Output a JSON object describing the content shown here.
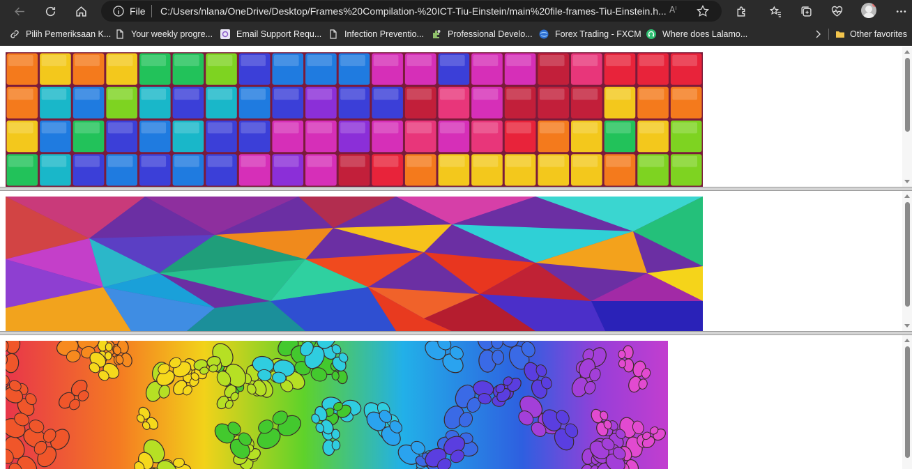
{
  "address_bar": {
    "scheme_label": "File",
    "url": "C:/Users/nlana/OneDrive/Desktop/Frames%20Compilation-%20ICT-Tiu-Einstein/main%20file-frames-Tiu-Einstein.h...",
    "read_aloud_label": "Aˡ"
  },
  "bookmarks": [
    {
      "label": "Pilih Pemeriksaan K...",
      "icon": "link-icon"
    },
    {
      "label": "Your weekly progre...",
      "icon": "page-icon"
    },
    {
      "label": "Email Support Requ...",
      "icon": "support-icon"
    },
    {
      "label": "Infection Preventio...",
      "icon": "page-icon"
    },
    {
      "label": "Professional Develo...",
      "icon": "puzzle-icon"
    },
    {
      "label": "Forex Trading - FXCM",
      "icon": "globe-icon"
    },
    {
      "label": "Where does Lalamo...",
      "icon": "headset-icon"
    }
  ],
  "other_favorites_label": "Other favorites",
  "frames": [
    {
      "image": "colorful-cubes"
    },
    {
      "image": "low-poly-triangles"
    },
    {
      "image": "rainbow-butterflies"
    }
  ],
  "colors": {
    "toolbar_bg": "#2b2b2b",
    "address_bg": "#1c1c1c",
    "folder": "#f3c54d",
    "divider": "#d4d4d4"
  }
}
